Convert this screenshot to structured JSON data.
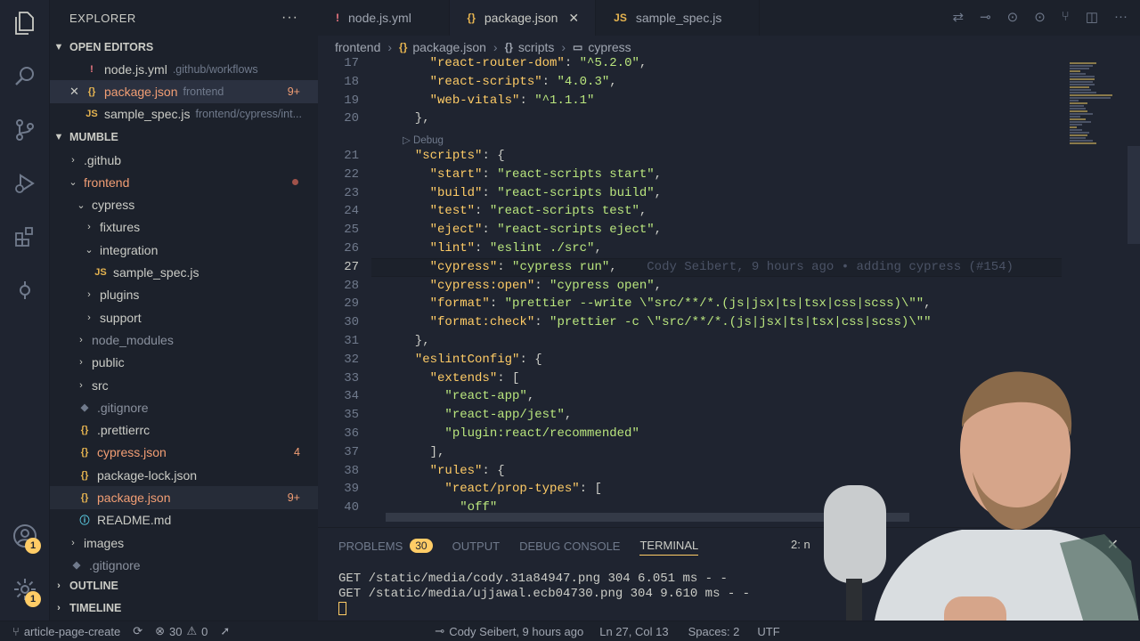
{
  "activity": {
    "badges": {
      "accounts": "1",
      "manage": "1"
    }
  },
  "sidebar": {
    "title": "EXPLORER",
    "open_editors": {
      "label": "OPEN EDITORS",
      "items": [
        {
          "icon": "!",
          "name": "node.js.yml",
          "desc": ".github/workflows",
          "mod": ""
        },
        {
          "icon": "{}",
          "name": "package.json",
          "desc": "frontend",
          "mod": "9+"
        },
        {
          "icon": "JS",
          "name": "sample_spec.js",
          "desc": "frontend/cypress/int...",
          "mod": ""
        }
      ]
    },
    "project": {
      "label": "MUMBLE",
      "items": [
        {
          "name": ".github",
          "depth": 0,
          "kind": "folder",
          "open": false
        },
        {
          "name": "frontend",
          "depth": 0,
          "kind": "folder",
          "open": true
        },
        {
          "name": "cypress",
          "depth": 1,
          "kind": "folder",
          "open": true
        },
        {
          "name": "fixtures",
          "depth": 2,
          "kind": "folder",
          "open": false
        },
        {
          "name": "integration",
          "depth": 2,
          "kind": "folder",
          "open": true
        },
        {
          "name": "sample_spec.js",
          "depth": 3,
          "kind": "file",
          "icon": "JS"
        },
        {
          "name": "plugins",
          "depth": 2,
          "kind": "folder",
          "open": false
        },
        {
          "name": "support",
          "depth": 2,
          "kind": "folder",
          "open": false
        },
        {
          "name": "node_modules",
          "depth": 1,
          "kind": "folder",
          "open": false
        },
        {
          "name": "public",
          "depth": 1,
          "kind": "folder",
          "open": false
        },
        {
          "name": "src",
          "depth": 1,
          "kind": "folder",
          "open": false
        },
        {
          "name": ".gitignore",
          "depth": 1,
          "kind": "file",
          "icon": "◆"
        },
        {
          "name": ".prettierrc",
          "depth": 1,
          "kind": "file",
          "icon": "{}"
        },
        {
          "name": "cypress.json",
          "depth": 1,
          "kind": "file",
          "icon": "{}",
          "mod": "4"
        },
        {
          "name": "package-lock.json",
          "depth": 1,
          "kind": "file",
          "icon": "{}"
        },
        {
          "name": "package.json",
          "depth": 1,
          "kind": "file",
          "icon": "{}",
          "mod": "9+"
        },
        {
          "name": "README.md",
          "depth": 1,
          "kind": "file",
          "icon": "ⓘ"
        },
        {
          "name": "images",
          "depth": 0,
          "kind": "folder",
          "open": false
        },
        {
          "name": ".gitignore",
          "depth": 0,
          "kind": "file",
          "icon": "◆"
        }
      ]
    },
    "outline": "OUTLINE",
    "timeline": "TIMELINE"
  },
  "tabs": [
    {
      "icon": "!",
      "label": "node.js.yml"
    },
    {
      "icon": "{}",
      "label": "package.json"
    },
    {
      "icon": "JS",
      "label": "sample_spec.js"
    }
  ],
  "breadcrumb": [
    "frontend",
    "package.json",
    "scripts",
    "cypress"
  ],
  "codelens": "Debug",
  "blame": "Cody Seibert, 9 hours ago • adding cypress (#154)",
  "code": [
    {
      "n": "17",
      "t": "    \"react-router-dom\": \"^5.2.0\","
    },
    {
      "n": "18",
      "t": "    \"react-scripts\": \"4.0.3\","
    },
    {
      "n": "19",
      "t": "    \"web-vitals\": \"^1.1.1\""
    },
    {
      "n": "20",
      "t": "  },"
    },
    {
      "n": "21",
      "t": "  \"scripts\": {"
    },
    {
      "n": "22",
      "t": "    \"start\": \"react-scripts start\","
    },
    {
      "n": "23",
      "t": "    \"build\": \"react-scripts build\","
    },
    {
      "n": "24",
      "t": "    \"test\": \"react-scripts test\","
    },
    {
      "n": "25",
      "t": "    \"eject\": \"react-scripts eject\","
    },
    {
      "n": "26",
      "t": "    \"lint\": \"eslint ./src\","
    },
    {
      "n": "27",
      "t": "    \"cypress\": \"cypress run\","
    },
    {
      "n": "28",
      "t": "    \"cypress:open\": \"cypress open\","
    },
    {
      "n": "29",
      "t": "    \"format\": \"prettier --write \\\"src/**/*.(js|jsx|ts|tsx|css|scss)\\\"\","
    },
    {
      "n": "30",
      "t": "    \"format:check\": \"prettier -c \\\"src/**/*.(js|jsx|ts|tsx|css|scss)\\\"\""
    },
    {
      "n": "31",
      "t": "  },"
    },
    {
      "n": "32",
      "t": "  \"eslintConfig\": {"
    },
    {
      "n": "33",
      "t": "    \"extends\": ["
    },
    {
      "n": "34",
      "t": "      \"react-app\","
    },
    {
      "n": "35",
      "t": "      \"react-app/jest\","
    },
    {
      "n": "36",
      "t": "      \"plugin:react/recommended\""
    },
    {
      "n": "37",
      "t": "    ],"
    },
    {
      "n": "38",
      "t": "    \"rules\": {"
    },
    {
      "n": "39",
      "t": "      \"react/prop-types\": ["
    },
    {
      "n": "40",
      "t": "        \"off\""
    }
  ],
  "panel": {
    "tabs": [
      {
        "label": "PROBLEMS",
        "badge": "30"
      },
      {
        "label": "OUTPUT",
        "badge": ""
      },
      {
        "label": "DEBUG CONSOLE",
        "badge": ""
      },
      {
        "label": "TERMINAL",
        "badge": ""
      }
    ],
    "terminal_select": "2: n",
    "terminal_lines": [
      "GET /static/media/cody.31a84947.png 304 6.051 ms - -",
      "GET /static/media/ujjawal.ecb04730.png 304 9.610 ms - -"
    ]
  },
  "status": {
    "branch": "article-page-create",
    "errors": "30",
    "warnings": "0",
    "author": "Cody Seibert, 9 hours ago",
    "position": "Ln 27, Col 13",
    "spaces": "Spaces: 2",
    "encoding": "UTF"
  },
  "colors": {
    "bg": "#1f2430",
    "key": "#ffcc66",
    "string": "#bae67e",
    "accent": "#ffcc66"
  }
}
